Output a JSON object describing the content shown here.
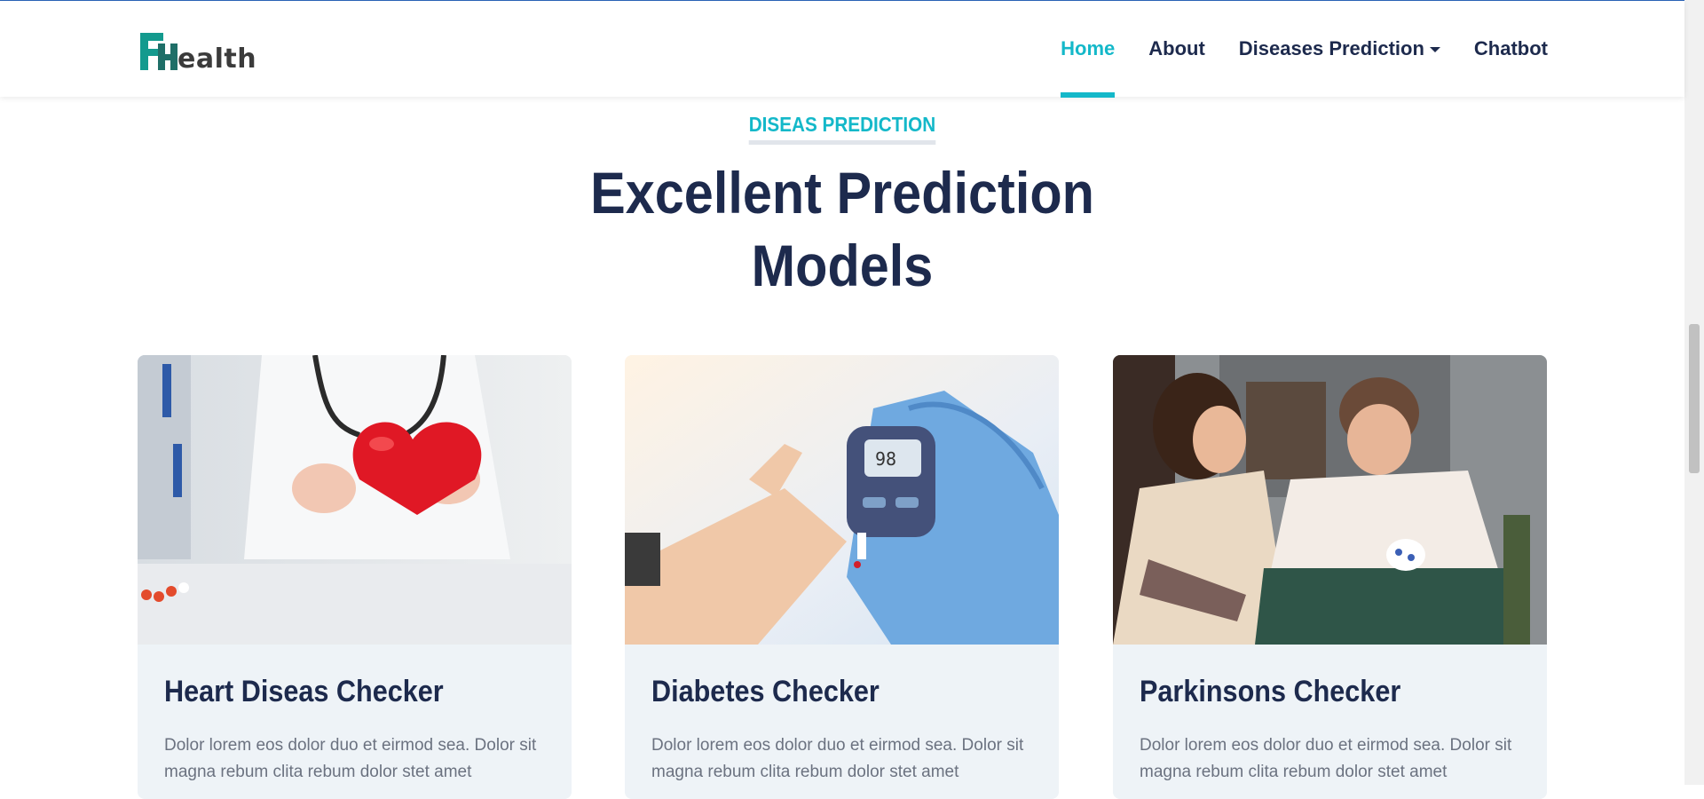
{
  "brand": {
    "logo_text": "ealth",
    "logo_letters": "FH"
  },
  "nav": {
    "items": [
      {
        "label": "Home",
        "active": true
      },
      {
        "label": "About",
        "active": false
      },
      {
        "label": "Diseases Prediction",
        "active": false,
        "dropdown": true
      },
      {
        "label": "Chatbot",
        "active": false
      }
    ]
  },
  "section": {
    "kicker": "DISEAS PREDICTION",
    "title": "Excellent Prediction Models"
  },
  "cards": [
    {
      "title": "Heart Diseas Checker",
      "text": "Dolor lorem eos dolor duo et eirmod sea. Dolor sit magna rebum clita rebum dolor stet amet",
      "image": "doctor holding red heart"
    },
    {
      "title": "Diabetes Checker",
      "text": "Dolor lorem eos dolor duo et eirmod sea. Dolor sit magna rebum clita rebum dolor stet amet",
      "image": "glucose meter finger test"
    },
    {
      "title": "Parkinsons Checker",
      "text": "Dolor lorem eos dolor duo et eirmod sea. Dolor sit magna rebum clita rebum dolor stet amet",
      "image": "caregiver with elderly woman"
    }
  ],
  "colors": {
    "accent": "#14b8c9",
    "heading": "#1d2a4d",
    "card_bg": "#eef3f7",
    "logo_teal": "#139a8e"
  }
}
